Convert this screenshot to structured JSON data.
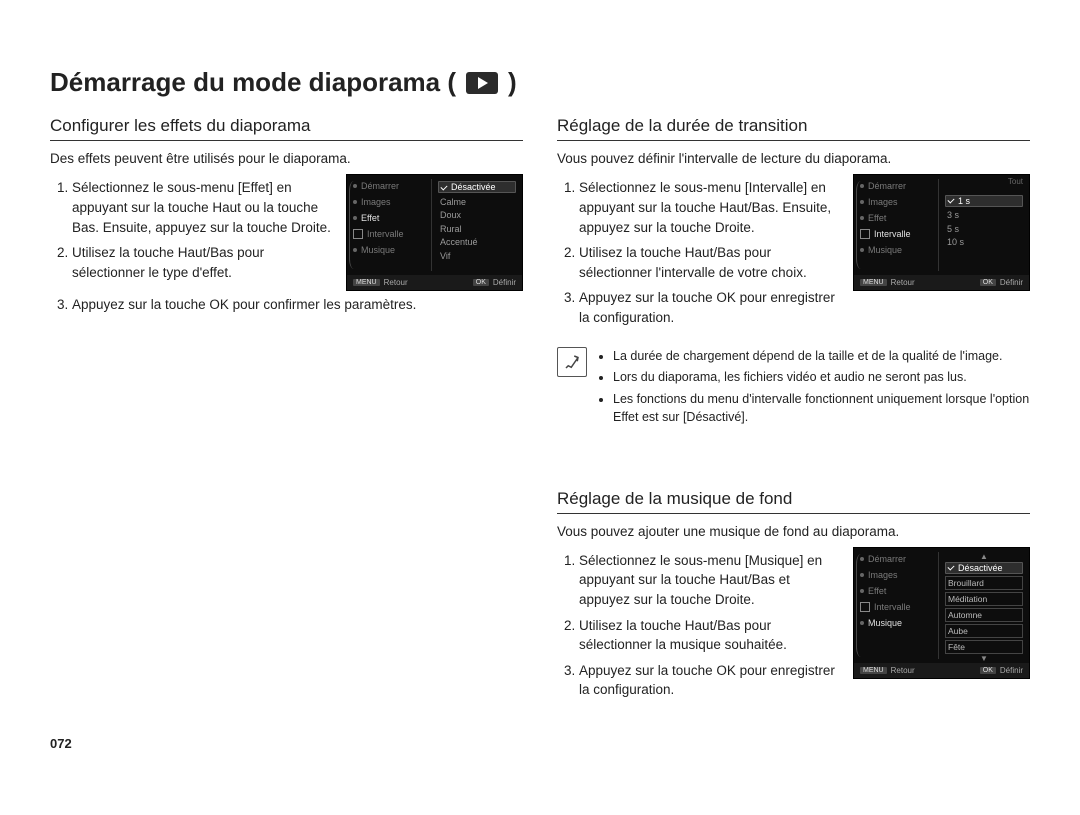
{
  "page_number": "072",
  "title_prefix": "Démarrage du mode diaporama (",
  "title_suffix": ")",
  "play_icon_name": "play-icon",
  "left": {
    "heading": "Configurer les effets du diaporama",
    "intro": "Des effets peuvent être utilisés pour le diaporama.",
    "step1": "Sélectionnez le sous-menu [Effet] en appuyant sur la touche Haut ou la touche Bas. Ensuite, appuyez sur la touche Droite.",
    "step2": "Utilisez la touche Haut/Bas pour sélectionner le type d'effet.",
    "step3": "Appuyez sur la touche OK pour confirmer les paramètres.",
    "screen": {
      "left_items": [
        "Démarrer",
        "Images",
        "Effet",
        "Intervalle",
        "Musique"
      ],
      "left_active_index": 2,
      "right_selected": "Désactivée",
      "right_items": [
        "Calme",
        "Doux",
        "Rural",
        "Accentué",
        "Vif"
      ],
      "foot_left_key": "MENU",
      "foot_left": "Retour",
      "foot_right_key": "OK",
      "foot_right": "Définir"
    }
  },
  "right_top": {
    "heading": "Réglage de la durée de transition",
    "intro": "Vous pouvez définir l'intervalle de lecture du diaporama.",
    "step1": "Sélectionnez le sous-menu [Intervalle] en appuyant sur la touche Haut/Bas. Ensuite, appuyez sur la touche Droite.",
    "step2": "Utilisez la touche Haut/Bas pour sélectionner l'intervalle de votre choix.",
    "step3": "Appuyez sur la touche OK pour enregistrer la configuration.",
    "screen": {
      "left_items": [
        "Démarrer",
        "Images",
        "Effet",
        "Intervalle",
        "Musique"
      ],
      "left_active_index": 3,
      "topright": "Tout",
      "right_selected": "1 s",
      "right_items": [
        "3 s",
        "5 s",
        "10 s"
      ],
      "foot_left_key": "MENU",
      "foot_left": "Retour",
      "foot_right_key": "OK",
      "foot_right": "Définir"
    },
    "notes": [
      "La durée de chargement dépend de la taille et de la qualité de l'image.",
      "Lors du diaporama, les fichiers vidéo et audio ne seront pas lus.",
      "Les fonctions du menu d'intervalle fonctionnent uniquement lorsque l'option Effet est sur [Désactivé]."
    ]
  },
  "right_bottom": {
    "heading": "Réglage de la musique de fond",
    "intro": "Vous pouvez ajouter une musique de fond au diaporama.",
    "step1": "Sélectionnez le sous-menu [Musique] en appuyant sur la touche Haut/Bas et appuyez sur la touche Droite.",
    "step2": "Utilisez la touche Haut/Bas pour sélectionner la musique souhaitée.",
    "step3": "Appuyez sur la touche OK pour enregistrer la configuration.",
    "screen": {
      "left_items": [
        "Démarrer",
        "Images",
        "Effet",
        "Intervalle",
        "Musique"
      ],
      "left_active_index": 4,
      "right_selected": "Désactivée",
      "right_items": [
        "Brouillard",
        "Méditation",
        "Automne",
        "Aube",
        "Fête"
      ],
      "foot_left_key": "MENU",
      "foot_left": "Retour",
      "foot_right_key": "OK",
      "foot_right": "Définir"
    }
  }
}
